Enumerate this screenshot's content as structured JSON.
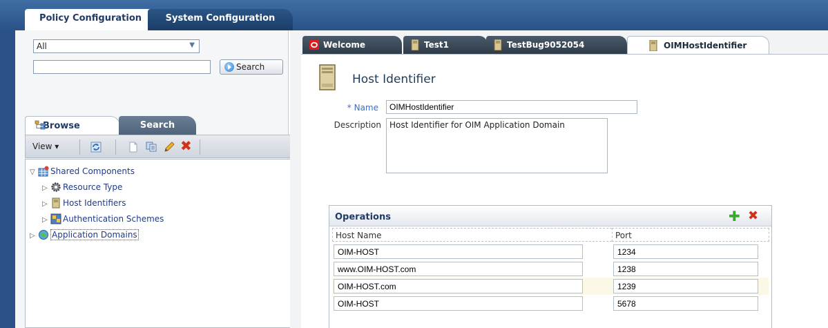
{
  "top_tabs": [
    {
      "label": "Policy Configuration",
      "active": true
    },
    {
      "label": "System Configuration",
      "active": false
    }
  ],
  "left_pane": {
    "scope_select": {
      "value": "All"
    },
    "search_input": {
      "value": ""
    },
    "search_button_label": "Search",
    "sub_tabs": [
      {
        "label": "Browse",
        "active": true
      },
      {
        "label": "Search",
        "active": false
      }
    ],
    "toolbar": {
      "view_label": "View ▾"
    },
    "tree": [
      {
        "label": "Shared Components",
        "level": 0,
        "expanded": true,
        "icon": "shared-components-icon"
      },
      {
        "label": "Resource Type",
        "level": 1,
        "expanded": false,
        "icon": "gear-icon"
      },
      {
        "label": "Host Identifiers",
        "level": 1,
        "expanded": false,
        "icon": "server-icon"
      },
      {
        "label": "Authentication Schemes",
        "level": 1,
        "expanded": false,
        "icon": "auth-scheme-icon"
      },
      {
        "label": "Application Domains",
        "level": 0,
        "expanded": false,
        "icon": "globe-icon"
      }
    ]
  },
  "doc_tabs": [
    {
      "label": "Welcome",
      "active": false,
      "icon": "oracle-icon"
    },
    {
      "label": "Test1",
      "active": false,
      "icon": "server-icon"
    },
    {
      "label": "TestBug9052054",
      "active": false,
      "icon": "server-icon"
    },
    {
      "label": "OIMHostIdentifier",
      "active": true,
      "icon": "server-icon"
    }
  ],
  "form": {
    "title": "Host Identifier",
    "name_label": "* Name",
    "name_value": "OIMHostIdentifier",
    "description_label": "Description",
    "description_value": "Host Identifier for OIM Application Domain"
  },
  "operations": {
    "title": "Operations",
    "columns": [
      "Host Name",
      "Port"
    ],
    "rows": [
      {
        "host": "OIM-HOST",
        "port": "1234"
      },
      {
        "host": "www.OIM-HOST.com",
        "port": "1238"
      },
      {
        "host": "OIM-HOST.com",
        "port": "1239"
      },
      {
        "host": "OIM-HOST",
        "port": "5678"
      }
    ]
  },
  "colors": {
    "brand_blue": "#2a5289",
    "add_green": "#39a82d",
    "delete_red": "#d33016"
  }
}
